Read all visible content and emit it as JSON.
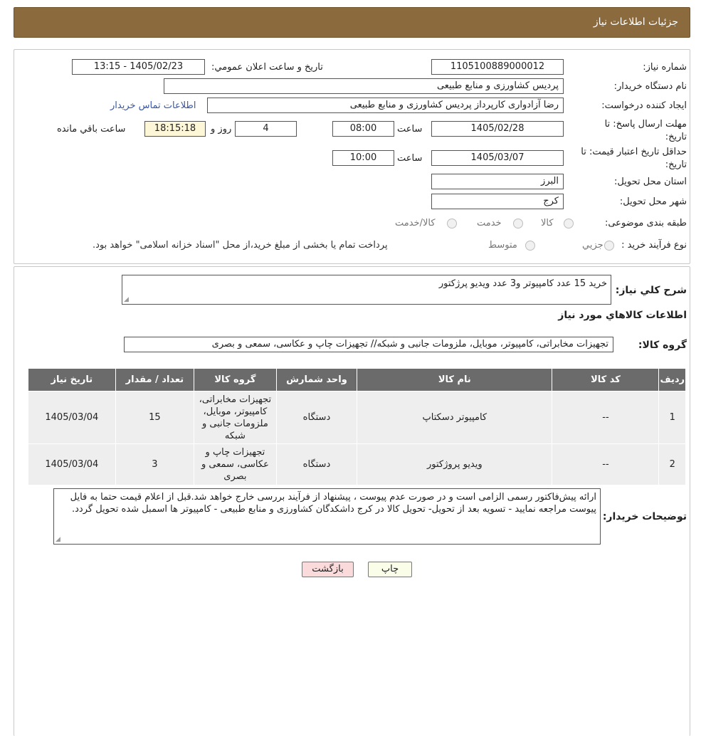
{
  "header": {
    "title": "جزئیات اطلاعات نیاز"
  },
  "form": {
    "need_number": {
      "label": "شماره نیاز:",
      "value": "1105100889000012"
    },
    "announce": {
      "label": "تاریخ و ساعت اعلان عمومي:",
      "value": "1405/02/23 - 13:15"
    },
    "buyer_org": {
      "label": "نام دستگاه خريدار:",
      "value": "پردیس کشاورزی و منابع طبیعی"
    },
    "creator": {
      "label": "ايجاد كننده درخواست:",
      "value": "رضا آزادواری کارپرداز پردیس کشاورزی و منابع طبیعی",
      "contact_link": "اطلاعات تماس خریدار"
    },
    "deadline": {
      "label": "مهلت ارسال پاسخ: تا تاریخ:",
      "date": "1405/02/28",
      "time_label": "ساعت",
      "time": "08:00",
      "days": "4",
      "days_label": "روز و",
      "remaining": "18:15:18",
      "remaining_label": "ساعت باقي مانده"
    },
    "validity": {
      "label": "حداقل تاريخ اعتبار قيمت: تا تاريخ:",
      "date": "1405/03/07",
      "time_label": "ساعت",
      "time": "10:00"
    },
    "province": {
      "label": "استان محل تحويل:",
      "value": "البرز"
    },
    "city": {
      "label": "شهر محل تحويل:",
      "value": "کرج"
    },
    "category": {
      "label": "طبقه بندی موضوعی:",
      "options": [
        "كالا",
        "خدمت",
        "كالا/خدمت"
      ]
    },
    "process": {
      "label": "نوع فرآيند خريد :",
      "options": [
        "جزيي",
        "متوسط"
      ],
      "note": "پرداخت تمام یا بخشی از مبلغ خرید،از محل \"اسناد خزانه اسلامی\" خواهد بود."
    }
  },
  "summary": {
    "label": "شرح كلي نياز:",
    "value": "خرید 15 عدد کامپیوتر و3 عدد  ویدیو پرژکتور"
  },
  "goods_title": "اطلاعات كالاهاي مورد نياز",
  "goods_group": {
    "label": "گروه كالا:",
    "value": "تجهیزات مخابراتی، کامپیوتر، موبایل، ملزومات جانبی و شبکه// تجهیزات چاپ و عکاسی، سمعی و بصری"
  },
  "table": {
    "headers": [
      "رديف",
      "كد كالا",
      "نام كالا",
      "واحد شمارش",
      "گروه كالا",
      "تعداد / مقدار",
      "تاريخ نياز"
    ],
    "rows": [
      [
        "1",
        "--",
        "کامپیوتر دسکتاپ",
        "دستگاه",
        "تجهیزات مخابراتی، کامپیوتر، موبایل، ملزومات جانبی و شبکه",
        "15",
        "1405/03/04"
      ],
      [
        "2",
        "--",
        "ویدیو پروژکتور",
        "دستگاه",
        "تجهیزات چاپ و عکاسی، سمعی و بصری",
        "3",
        "1405/03/04"
      ]
    ]
  },
  "buyer_notes": {
    "label": "توضيحات خريدار:",
    "value": "ارائه پیش‌فاکتور رسمی الزامی است و در صورت عدم پیوست ، پیشنهاد از فرآیند بررسی خارج خواهد شد.قبل از اعلام قیمت حتما به فایل پیوست مراجعه نمایید - تسویه بعد از تحویل- تحویل کالا در کرج داشکدگان کشاورزی و منابع طبیعی - کامپیوتر ها اسمبل شده تحویل گردد."
  },
  "buttons": {
    "print": "چاپ",
    "back": "بازگشت"
  },
  "colors": {
    "header_bg": "#8b6b3e",
    "table_header_bg": "#6b6b6b",
    "link": "#3a57a8",
    "back_button_bg": "#fadada"
  }
}
